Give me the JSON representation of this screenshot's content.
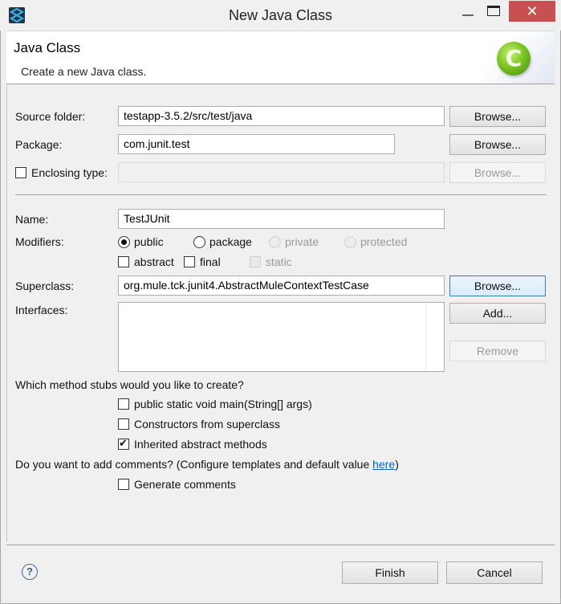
{
  "window": {
    "title": "New Java Class",
    "controls": {
      "minimize": "—",
      "maximize": "",
      "close": "✕"
    }
  },
  "banner": {
    "title": "Java Class",
    "description": "Create a new Java class.",
    "icon_glyph": "C"
  },
  "form": {
    "source_folder": {
      "label": "Source folder:",
      "value": "testapp-3.5.2/src/test/java",
      "browse": "Browse..."
    },
    "package": {
      "label": "Package:",
      "value": "com.junit.test",
      "browse": "Browse..."
    },
    "enclosing_type": {
      "label": "Enclosing type:",
      "value": "",
      "checked": false,
      "browse": "Browse..."
    },
    "name": {
      "label": "Name:",
      "value": "TestJUnit"
    },
    "modifiers": {
      "label": "Modifiers:",
      "access": [
        {
          "label": "public",
          "selected": true,
          "enabled": true
        },
        {
          "label": "package",
          "selected": false,
          "enabled": true
        },
        {
          "label": "private",
          "selected": false,
          "enabled": false
        },
        {
          "label": "protected",
          "selected": false,
          "enabled": false
        }
      ],
      "flags": [
        {
          "label": "abstract",
          "checked": false,
          "enabled": true
        },
        {
          "label": "final",
          "checked": false,
          "enabled": true
        },
        {
          "label": "static",
          "checked": false,
          "enabled": false
        }
      ]
    },
    "superclass": {
      "label": "Superclass:",
      "value": "org.mule.tck.junit4.AbstractMuleContextTestCase",
      "browse": "Browse..."
    },
    "interfaces": {
      "label": "Interfaces:",
      "items": [],
      "add": "Add...",
      "remove": "Remove"
    },
    "stubs": {
      "question": "Which method stubs would you like to create?",
      "options": [
        {
          "label": "public static void main(String[] args)",
          "checked": false
        },
        {
          "label": "Constructors from superclass",
          "checked": false
        },
        {
          "label": "Inherited abstract methods",
          "checked": true
        }
      ]
    },
    "comments": {
      "question_prefix": "Do you want to add comments? (Configure templates and default value ",
      "link": "here",
      "question_suffix": ")",
      "option": {
        "label": "Generate comments",
        "checked": false
      }
    }
  },
  "footer": {
    "help_icon": "?",
    "finish": "Finish",
    "cancel": "Cancel"
  }
}
